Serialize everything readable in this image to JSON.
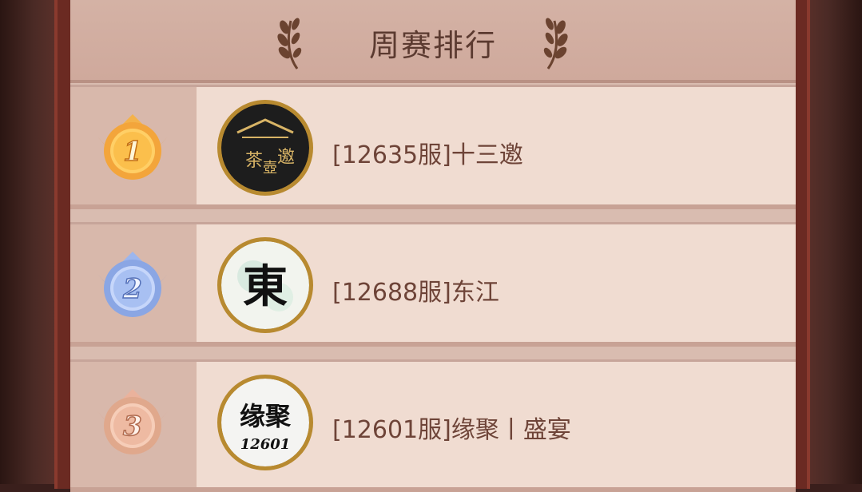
{
  "header": {
    "title": "周赛排行"
  },
  "rows": [
    {
      "rank": "1",
      "name": "[12635服]十三邀",
      "avatar_icon": "tea-guild-emblem-icon",
      "medal_color": "#f0a63a"
    },
    {
      "rank": "2",
      "name": "[12688服]东江",
      "avatar_icon": "dong-calligraphy-emblem-icon",
      "medal_color": "#8aa6e4"
    },
    {
      "rank": "3",
      "name": "[12601服]缘聚丨盛宴",
      "avatar_icon": "yuanju-emblem-icon",
      "medal_color": "#e0a88c",
      "avatar_caption": "12601"
    }
  ]
}
